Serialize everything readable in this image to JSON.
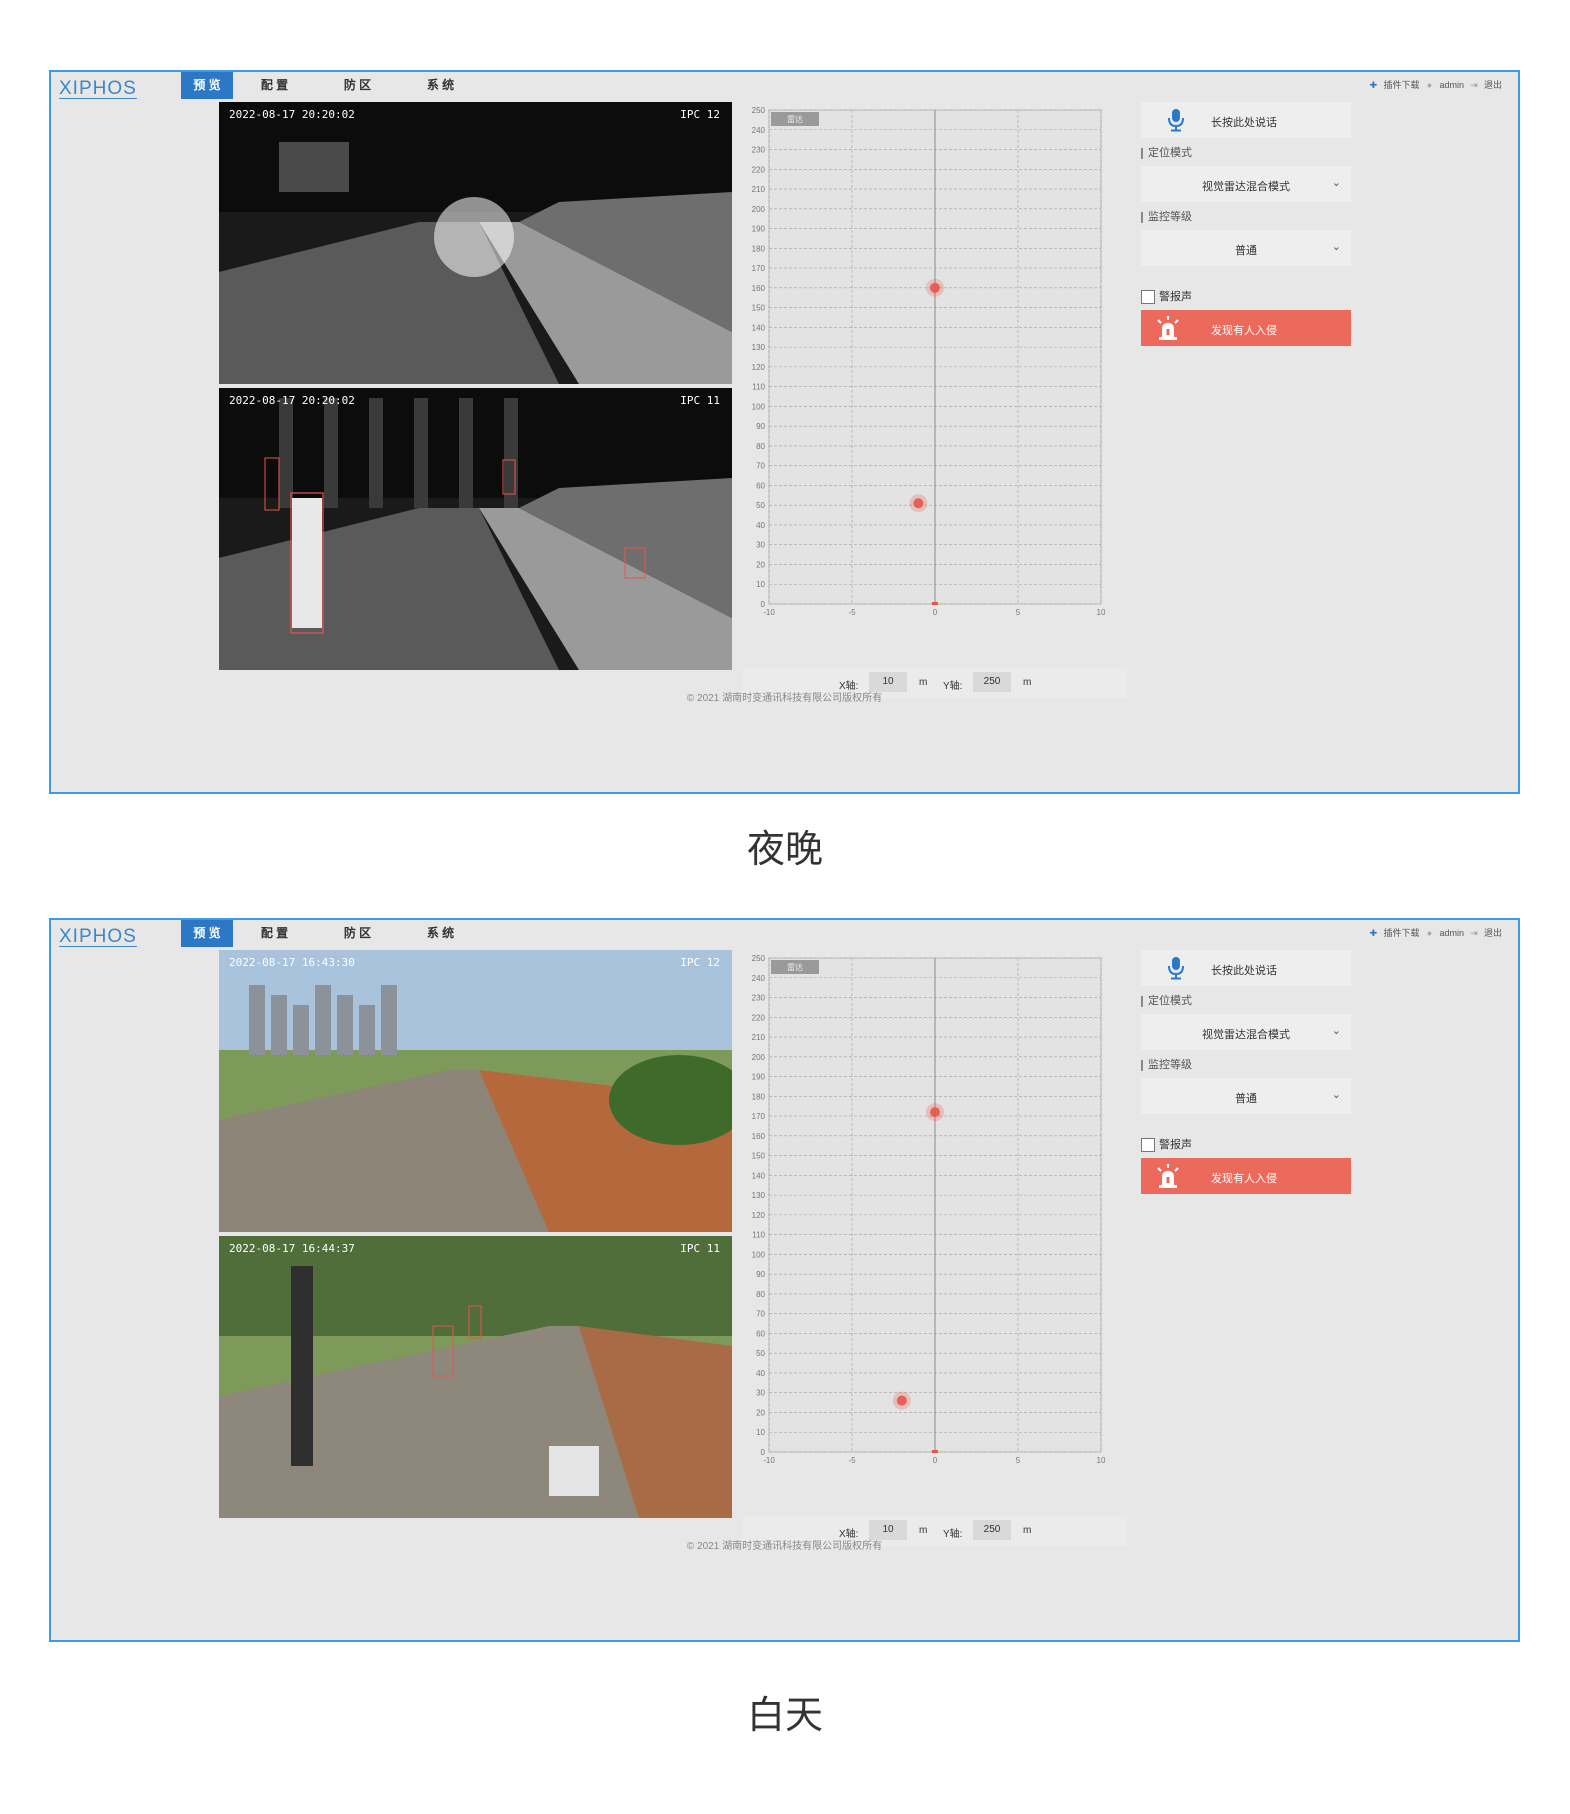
{
  "header": {
    "logo": "XIPHOS",
    "nav": [
      {
        "label": "预 览",
        "active": true
      },
      {
        "label": "配 置",
        "active": false
      },
      {
        "label": "防 区",
        "active": false
      },
      {
        "label": "系 统",
        "active": false
      }
    ],
    "plugin_label": "插件下载",
    "user_label": "admin",
    "logout_label": "退出"
  },
  "panel": {
    "talk_label": "长按此处说话",
    "mode_title": "定位模式",
    "mode_value": "视觉雷达混合模式",
    "level_title": "监控等级",
    "level_value": "普通",
    "alarm_sound_label": "警报声",
    "alarm_banner": "发现有人入侵"
  },
  "axis": {
    "x_label": "X轴:",
    "x_value": "10",
    "y_label": "Y轴:",
    "y_value": "250",
    "unit": "m"
  },
  "radar_tag": "雷达",
  "footer": "© 2021 湖南时变通讯科技有限公司版权所有",
  "screens": {
    "night": {
      "caption": "夜晚",
      "cams": [
        {
          "timestamp": "2022-08-17 20:20:02",
          "name": "IPC 12"
        },
        {
          "timestamp": "2022-08-17 20:20:02",
          "name": "IPC 11"
        }
      ],
      "chart_data": {
        "type": "scatter",
        "xlim": [
          -10,
          10
        ],
        "ylim": [
          0,
          250
        ],
        "xticks": [
          -10,
          -5,
          0,
          5,
          10
        ],
        "yticks": [
          0,
          10,
          20,
          30,
          40,
          50,
          60,
          70,
          80,
          90,
          100,
          110,
          120,
          130,
          140,
          150,
          160,
          170,
          180,
          190,
          200,
          210,
          220,
          230,
          240,
          250
        ],
        "grid": true,
        "points": [
          {
            "x": 0,
            "y": 160
          },
          {
            "x": -1,
            "y": 51
          }
        ]
      }
    },
    "day": {
      "caption": "白天",
      "cams": [
        {
          "timestamp": "2022-08-17 16:43:30",
          "name": "IPC 12"
        },
        {
          "timestamp": "2022-08-17 16:44:37",
          "name": "IPC 11"
        }
      ],
      "chart_data": {
        "type": "scatter",
        "xlim": [
          -10,
          10
        ],
        "ylim": [
          0,
          250
        ],
        "xticks": [
          -10,
          -5,
          0,
          5,
          10
        ],
        "yticks": [
          0,
          10,
          20,
          30,
          40,
          50,
          60,
          70,
          80,
          90,
          100,
          110,
          120,
          130,
          140,
          150,
          160,
          170,
          180,
          190,
          200,
          210,
          220,
          230,
          240,
          250
        ],
        "grid": true,
        "points": [
          {
            "x": 0,
            "y": 172
          },
          {
            "x": -2,
            "y": 26
          }
        ]
      }
    }
  },
  "colors": {
    "accent": "#2c78c7",
    "alarm": "#ec6a5c",
    "frame": "#3d9ae3",
    "target": "#e8544a"
  }
}
